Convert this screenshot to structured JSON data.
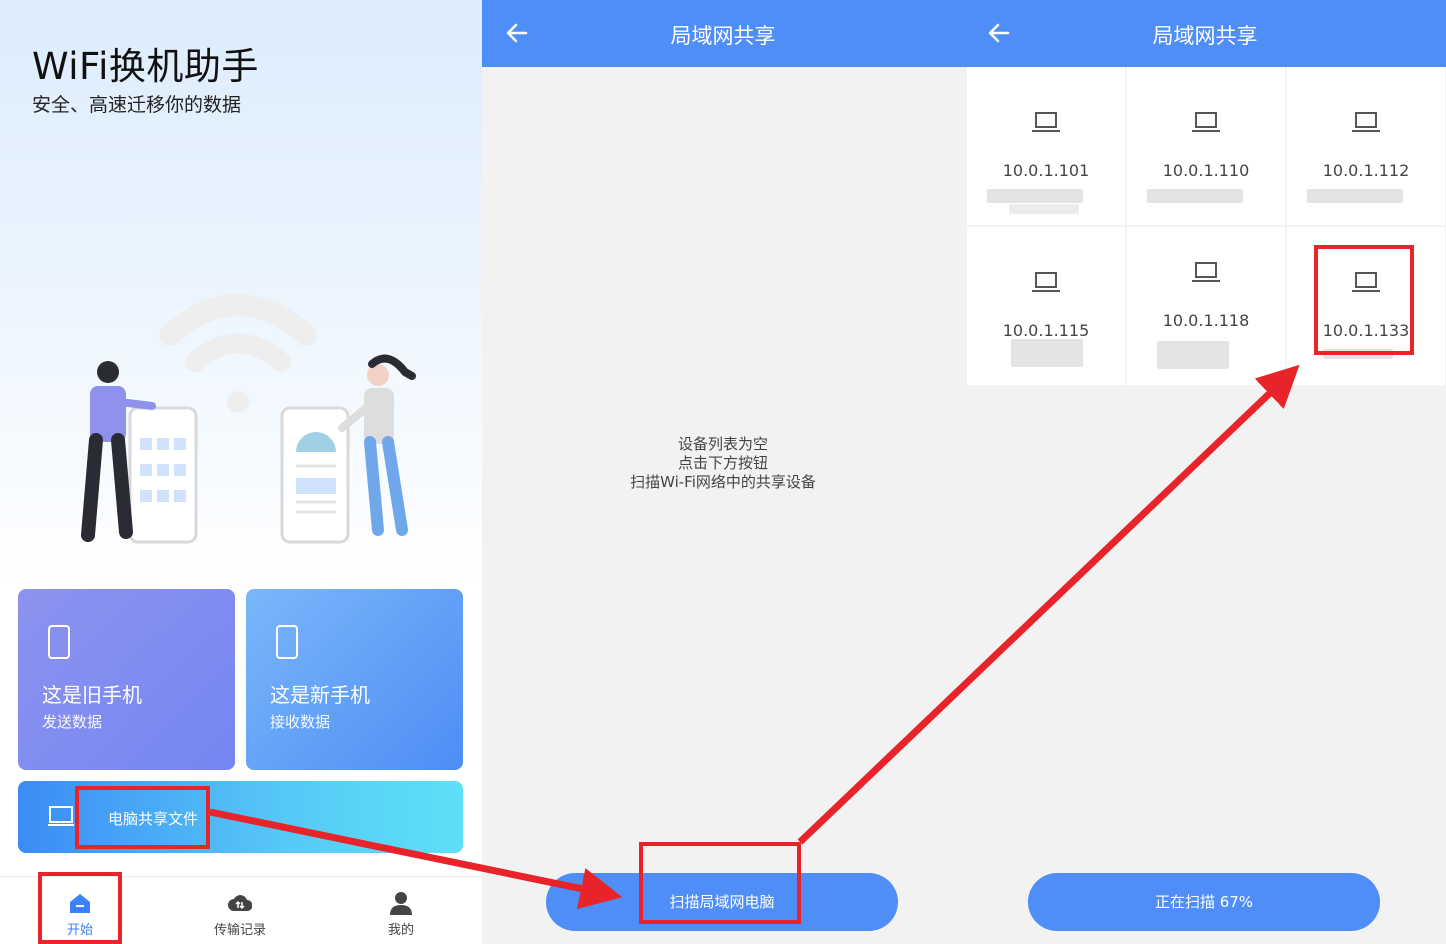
{
  "home": {
    "title": "WiFi换机助手",
    "subtitle": "安全、高速迁移你的数据",
    "old_phone": {
      "title": "这是旧手机",
      "subtitle": "发送数据"
    },
    "new_phone": {
      "title": "这是新手机",
      "subtitle": "接收数据"
    },
    "pc_share_label": "电脑共享文件",
    "nav": [
      {
        "label": "开始",
        "icon": "home-icon",
        "active": true
      },
      {
        "label": "传输记录",
        "icon": "cloud-transfer-icon",
        "active": false
      },
      {
        "label": "我的",
        "icon": "person-icon",
        "active": false
      }
    ]
  },
  "lan_empty": {
    "header_title": "局域网共享",
    "empty_lines": [
      "设备列表为空",
      "点击下方按钮",
      "扫描Wi-Fi网络中的共享设备"
    ],
    "scan_button": "扫描局域网电脑"
  },
  "lan_scanning": {
    "header_title": "局域网共享",
    "devices": [
      {
        "ip": "10.0.1.101"
      },
      {
        "ip": "10.0.1.110"
      },
      {
        "ip": "10.0.1.112"
      },
      {
        "ip": "10.0.1.115"
      },
      {
        "ip": "10.0.1.118"
      },
      {
        "ip": "10.0.1.133"
      }
    ],
    "scan_status": "正在扫描 67%"
  },
  "colors": {
    "header_blue": "#4f8ef7",
    "annotation_red": "#e8232a",
    "old_card": "#8089f1",
    "new_card": "#5a98f6"
  }
}
